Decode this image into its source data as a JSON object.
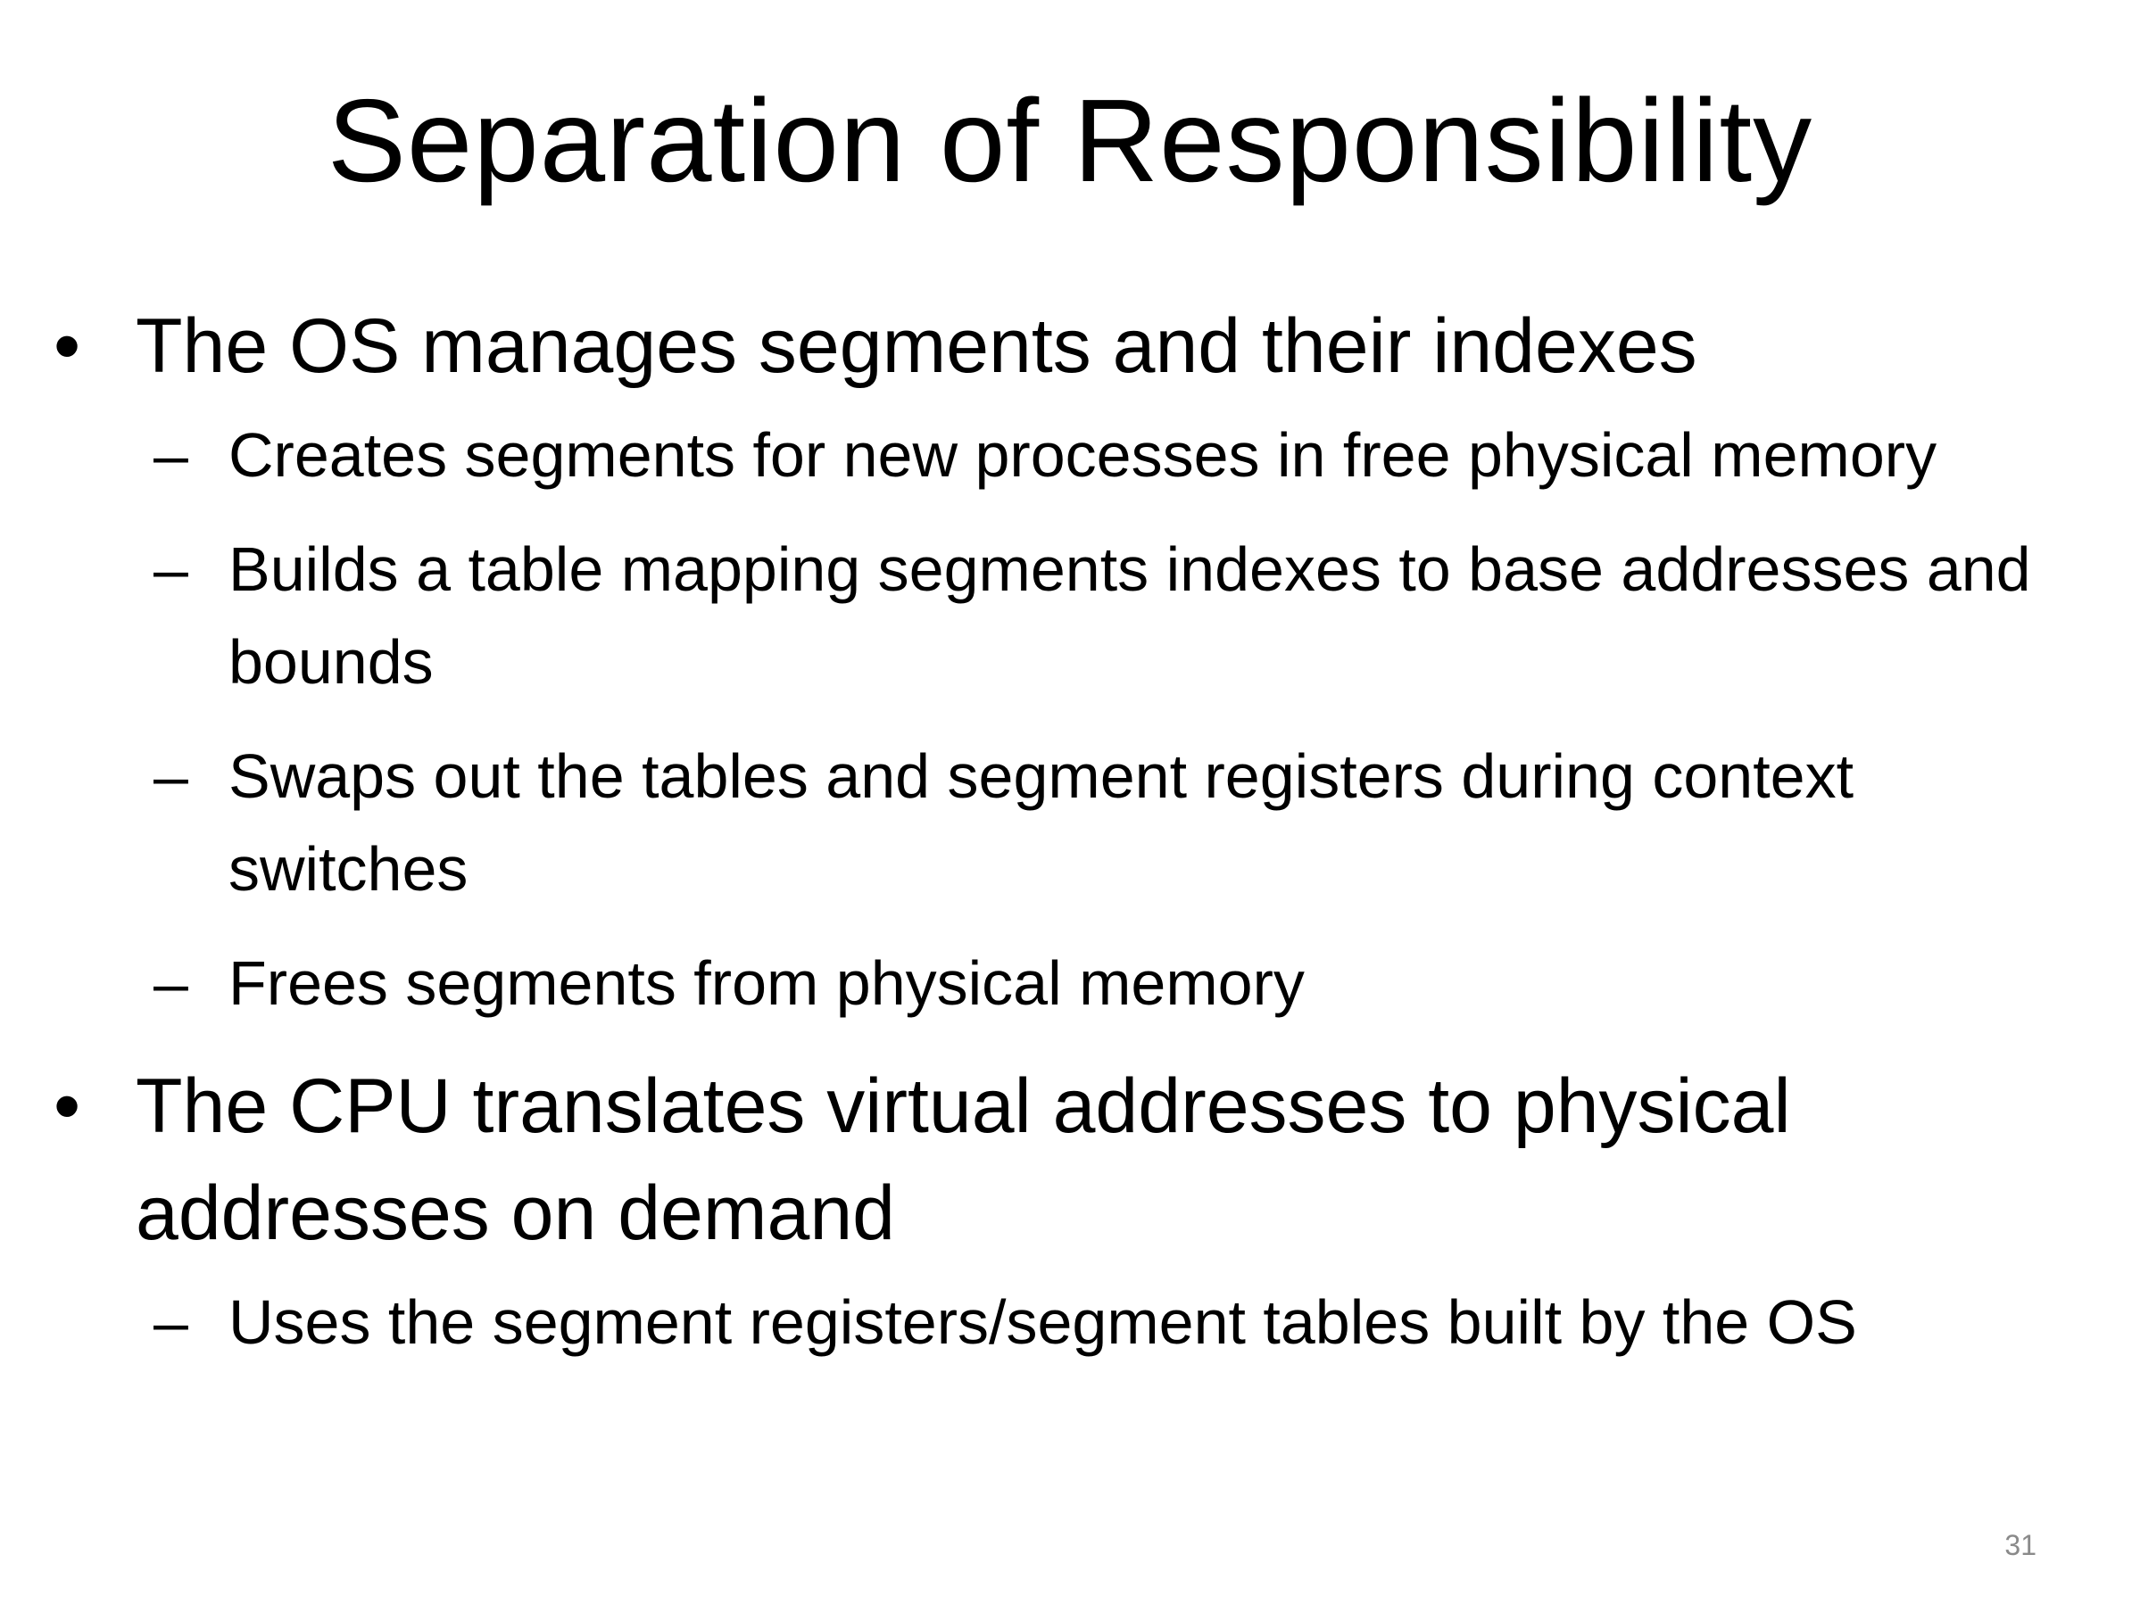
{
  "slide": {
    "title": "Separation of Responsibility",
    "bullets": [
      {
        "text": "The OS manages segments and their indexes",
        "sub": [
          "Creates segments for new processes in free physical memory",
          "Builds a table mapping segments indexes to base addresses and bounds",
          "Swaps out the tables and segment registers during context switches",
          "Frees segments from physical memory"
        ]
      },
      {
        "text": "The CPU translates virtual addresses to physical addresses on demand",
        "sub": [
          "Uses the segment registers/segment tables built by the OS"
        ]
      }
    ],
    "bullet_glyph": "•",
    "sub_bullet_glyph": "–",
    "page_number": "31"
  }
}
